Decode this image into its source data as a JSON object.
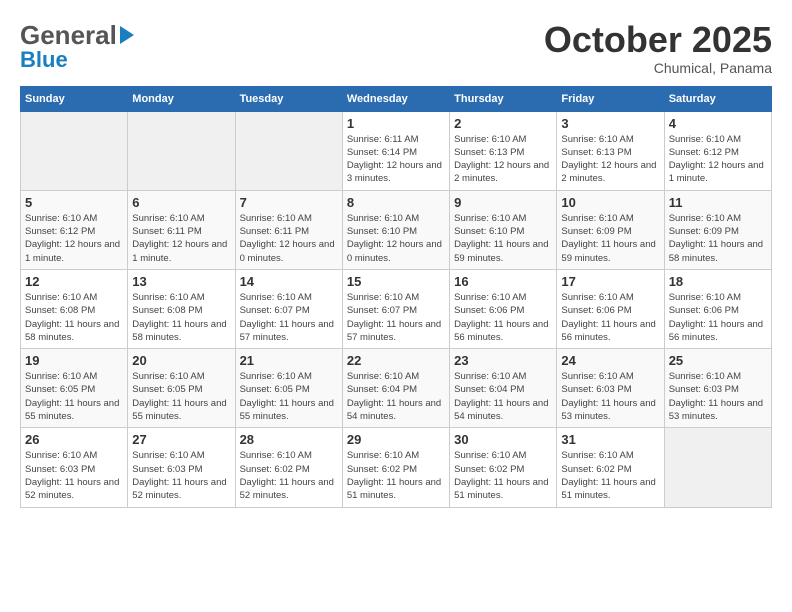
{
  "header": {
    "logo_general": "General",
    "logo_blue": "Blue",
    "month_title": "October 2025",
    "subtitle": "Chumical, Panama"
  },
  "days_of_week": [
    "Sunday",
    "Monday",
    "Tuesday",
    "Wednesday",
    "Thursday",
    "Friday",
    "Saturday"
  ],
  "weeks": [
    [
      {
        "day": "",
        "info": ""
      },
      {
        "day": "",
        "info": ""
      },
      {
        "day": "",
        "info": ""
      },
      {
        "day": "1",
        "info": "Sunrise: 6:11 AM\nSunset: 6:14 PM\nDaylight: 12 hours and 3 minutes."
      },
      {
        "day": "2",
        "info": "Sunrise: 6:10 AM\nSunset: 6:13 PM\nDaylight: 12 hours and 2 minutes."
      },
      {
        "day": "3",
        "info": "Sunrise: 6:10 AM\nSunset: 6:13 PM\nDaylight: 12 hours and 2 minutes."
      },
      {
        "day": "4",
        "info": "Sunrise: 6:10 AM\nSunset: 6:12 PM\nDaylight: 12 hours and 1 minute."
      }
    ],
    [
      {
        "day": "5",
        "info": "Sunrise: 6:10 AM\nSunset: 6:12 PM\nDaylight: 12 hours and 1 minute."
      },
      {
        "day": "6",
        "info": "Sunrise: 6:10 AM\nSunset: 6:11 PM\nDaylight: 12 hours and 1 minute."
      },
      {
        "day": "7",
        "info": "Sunrise: 6:10 AM\nSunset: 6:11 PM\nDaylight: 12 hours and 0 minutes."
      },
      {
        "day": "8",
        "info": "Sunrise: 6:10 AM\nSunset: 6:10 PM\nDaylight: 12 hours and 0 minutes."
      },
      {
        "day": "9",
        "info": "Sunrise: 6:10 AM\nSunset: 6:10 PM\nDaylight: 11 hours and 59 minutes."
      },
      {
        "day": "10",
        "info": "Sunrise: 6:10 AM\nSunset: 6:09 PM\nDaylight: 11 hours and 59 minutes."
      },
      {
        "day": "11",
        "info": "Sunrise: 6:10 AM\nSunset: 6:09 PM\nDaylight: 11 hours and 58 minutes."
      }
    ],
    [
      {
        "day": "12",
        "info": "Sunrise: 6:10 AM\nSunset: 6:08 PM\nDaylight: 11 hours and 58 minutes."
      },
      {
        "day": "13",
        "info": "Sunrise: 6:10 AM\nSunset: 6:08 PM\nDaylight: 11 hours and 58 minutes."
      },
      {
        "day": "14",
        "info": "Sunrise: 6:10 AM\nSunset: 6:07 PM\nDaylight: 11 hours and 57 minutes."
      },
      {
        "day": "15",
        "info": "Sunrise: 6:10 AM\nSunset: 6:07 PM\nDaylight: 11 hours and 57 minutes."
      },
      {
        "day": "16",
        "info": "Sunrise: 6:10 AM\nSunset: 6:06 PM\nDaylight: 11 hours and 56 minutes."
      },
      {
        "day": "17",
        "info": "Sunrise: 6:10 AM\nSunset: 6:06 PM\nDaylight: 11 hours and 56 minutes."
      },
      {
        "day": "18",
        "info": "Sunrise: 6:10 AM\nSunset: 6:06 PM\nDaylight: 11 hours and 56 minutes."
      }
    ],
    [
      {
        "day": "19",
        "info": "Sunrise: 6:10 AM\nSunset: 6:05 PM\nDaylight: 11 hours and 55 minutes."
      },
      {
        "day": "20",
        "info": "Sunrise: 6:10 AM\nSunset: 6:05 PM\nDaylight: 11 hours and 55 minutes."
      },
      {
        "day": "21",
        "info": "Sunrise: 6:10 AM\nSunset: 6:05 PM\nDaylight: 11 hours and 55 minutes."
      },
      {
        "day": "22",
        "info": "Sunrise: 6:10 AM\nSunset: 6:04 PM\nDaylight: 11 hours and 54 minutes."
      },
      {
        "day": "23",
        "info": "Sunrise: 6:10 AM\nSunset: 6:04 PM\nDaylight: 11 hours and 54 minutes."
      },
      {
        "day": "24",
        "info": "Sunrise: 6:10 AM\nSunset: 6:03 PM\nDaylight: 11 hours and 53 minutes."
      },
      {
        "day": "25",
        "info": "Sunrise: 6:10 AM\nSunset: 6:03 PM\nDaylight: 11 hours and 53 minutes."
      }
    ],
    [
      {
        "day": "26",
        "info": "Sunrise: 6:10 AM\nSunset: 6:03 PM\nDaylight: 11 hours and 52 minutes."
      },
      {
        "day": "27",
        "info": "Sunrise: 6:10 AM\nSunset: 6:03 PM\nDaylight: 11 hours and 52 minutes."
      },
      {
        "day": "28",
        "info": "Sunrise: 6:10 AM\nSunset: 6:02 PM\nDaylight: 11 hours and 52 minutes."
      },
      {
        "day": "29",
        "info": "Sunrise: 6:10 AM\nSunset: 6:02 PM\nDaylight: 11 hours and 51 minutes."
      },
      {
        "day": "30",
        "info": "Sunrise: 6:10 AM\nSunset: 6:02 PM\nDaylight: 11 hours and 51 minutes."
      },
      {
        "day": "31",
        "info": "Sunrise: 6:10 AM\nSunset: 6:02 PM\nDaylight: 11 hours and 51 minutes."
      },
      {
        "day": "",
        "info": ""
      }
    ]
  ]
}
